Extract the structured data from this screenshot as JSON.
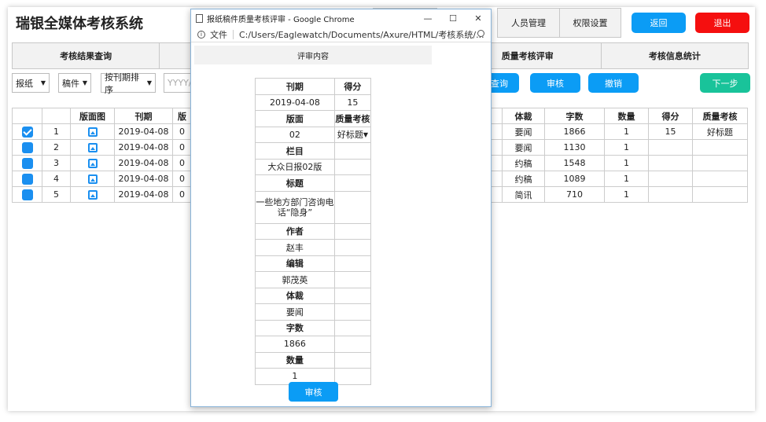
{
  "app": {
    "title": "瑞银全媒体考核系统"
  },
  "topnav": {
    "user_mgmt": "人员管理",
    "perm_settings": "权限设置",
    "back": "返回",
    "logout": "退出"
  },
  "tabs": [
    "考核结果查询",
    "",
    "",
    "质量考核评审",
    "考核信息统计"
  ],
  "filters": {
    "newspaper": "报纸",
    "manuscript": "稿件",
    "sort": "按刊期排序",
    "date_placeholder": "YYYY/M"
  },
  "actions": {
    "query": "查询",
    "review": "审核",
    "revoke": "撤销",
    "next": "下一步"
  },
  "left_table": {
    "headers": [
      "",
      "",
      "版面图",
      "刊期",
      "版"
    ],
    "rows": [
      {
        "checked": true,
        "no": "1",
        "date": "2019-04-08",
        "page": "0"
      },
      {
        "checked": false,
        "no": "2",
        "date": "2019-04-08",
        "page": "0"
      },
      {
        "checked": false,
        "no": "3",
        "date": "2019-04-08",
        "page": "0"
      },
      {
        "checked": false,
        "no": "4",
        "date": "2019-04-08",
        "page": "0"
      },
      {
        "checked": false,
        "no": "5",
        "date": "2019-04-08",
        "page": "0"
      }
    ]
  },
  "right_table": {
    "headers": [
      "",
      "体裁",
      "字数",
      "数量",
      "得分",
      "质量考核"
    ],
    "rows": [
      {
        "c0": "",
        "genre": "要闻",
        "words": "1866",
        "qty": "1",
        "score": "15",
        "quality": "好标题"
      },
      {
        "c0": "",
        "genre": "要闻",
        "words": "1130",
        "qty": "1",
        "score": "",
        "quality": ""
      },
      {
        "c0": "",
        "genre": "约稿",
        "words": "1548",
        "qty": "1",
        "score": "",
        "quality": ""
      },
      {
        "c0": "",
        "genre": "约稿",
        "words": "1089",
        "qty": "1",
        "score": "",
        "quality": ""
      },
      {
        "c0": "",
        "genre": "简讯",
        "words": "710",
        "qty": "1",
        "score": "",
        "quality": ""
      }
    ]
  },
  "popup": {
    "window_title": "报纸稿件质量考核评审 - Google Chrome",
    "addr_label": "文件",
    "url": "C:/Users/Eaglewatch/Documents/Axure/HTML/考核系统/...",
    "header": "评审内容",
    "fields": {
      "issue_label": "刊期",
      "issue": "2019-04-08",
      "score_label": "得分",
      "score": "15",
      "page_label": "版面",
      "page": "02",
      "quality_label": "质量考核",
      "quality": "好标题",
      "column_label": "栏目",
      "column": "大众日报02版",
      "headline_label": "标题",
      "headline": "一些地方部门咨询电话“隐身”",
      "author_label": "作者",
      "author": "赵丰",
      "editor_label": "编辑",
      "editor": "郭茂英",
      "genre_label": "体裁",
      "genre": "要闻",
      "words_label": "字数",
      "words": "1866",
      "qty_label": "数量",
      "qty": "1"
    },
    "submit": "审核"
  }
}
